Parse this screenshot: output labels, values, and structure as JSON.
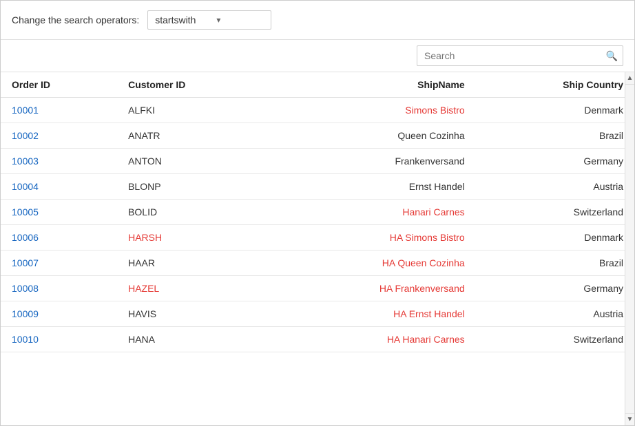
{
  "topbar": {
    "label": "Change the search operators:",
    "operator_value": "startswith",
    "chevron": "▾"
  },
  "search": {
    "placeholder": "Search",
    "icon": "🔍"
  },
  "table": {
    "columns": [
      {
        "key": "orderid",
        "label": "Order ID"
      },
      {
        "key": "customerid",
        "label": "Customer ID"
      },
      {
        "key": "shipname",
        "label": "ShipName"
      },
      {
        "key": "country",
        "label": "Ship Country"
      }
    ],
    "rows": [
      {
        "orderid": "10001",
        "customerid": "ALFKI",
        "customerid_highlight": false,
        "shipname": "Simons Bistro",
        "shipname_highlight": true,
        "country": "Denmark"
      },
      {
        "orderid": "10002",
        "customerid": "ANATR",
        "customerid_highlight": false,
        "shipname": "Queen Cozinha",
        "shipname_highlight": false,
        "country": "Brazil"
      },
      {
        "orderid": "10003",
        "customerid": "ANTON",
        "customerid_highlight": false,
        "shipname": "Frankenversand",
        "shipname_highlight": false,
        "country": "Germany"
      },
      {
        "orderid": "10004",
        "customerid": "BLONP",
        "customerid_highlight": false,
        "shipname": "Ernst Handel",
        "shipname_highlight": false,
        "country": "Austria"
      },
      {
        "orderid": "10005",
        "customerid": "BOLID",
        "customerid_highlight": false,
        "shipname": "Hanari Carnes",
        "shipname_highlight": true,
        "country": "Switzerland"
      },
      {
        "orderid": "10006",
        "customerid": "HARSH",
        "customerid_highlight": true,
        "shipname": "HA Simons Bistro",
        "shipname_highlight": true,
        "country": "Denmark"
      },
      {
        "orderid": "10007",
        "customerid": "HAAR",
        "customerid_highlight": false,
        "shipname": "HA Queen Cozinha",
        "shipname_highlight": true,
        "country": "Brazil"
      },
      {
        "orderid": "10008",
        "customerid": "HAZEL",
        "customerid_highlight": true,
        "shipname": "HA Frankenversand",
        "shipname_highlight": true,
        "country": "Germany"
      },
      {
        "orderid": "10009",
        "customerid": "HAVIS",
        "customerid_highlight": false,
        "shipname": "HA Ernst Handel",
        "shipname_highlight": true,
        "country": "Austria"
      },
      {
        "orderid": "10010",
        "customerid": "HANA",
        "customerid_highlight": false,
        "shipname": "HA Hanari Carnes",
        "shipname_highlight": true,
        "country": "Switzerland"
      }
    ]
  },
  "scroll": {
    "up_arrow": "▲",
    "down_arrow": "▼"
  }
}
